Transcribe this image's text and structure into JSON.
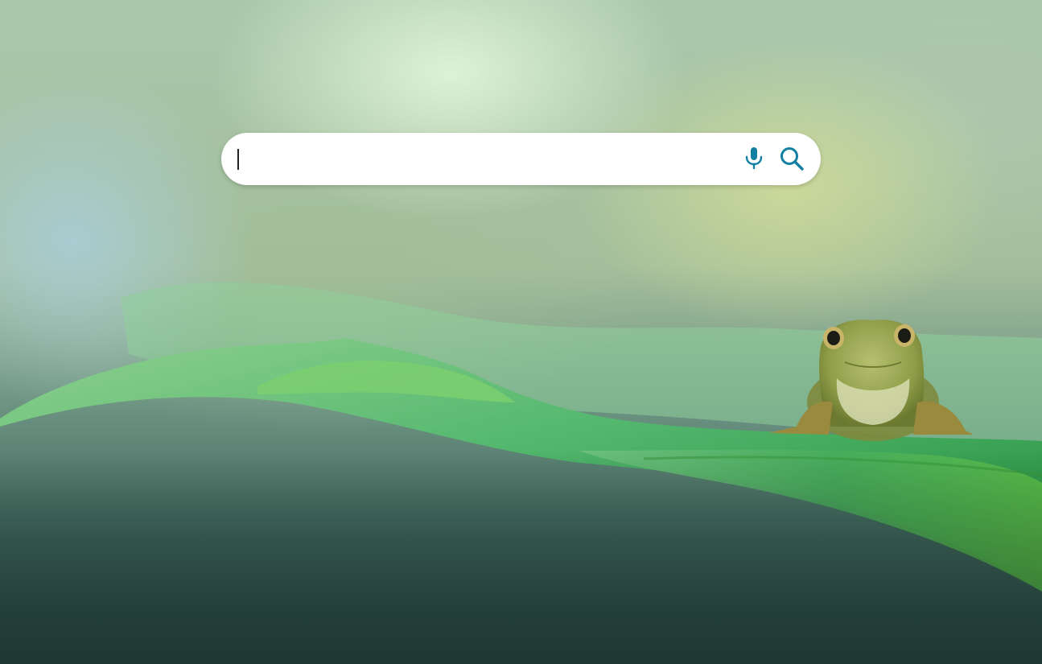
{
  "search": {
    "value": "",
    "placeholder": "",
    "mic_icon": "microphone-icon",
    "search_icon": "magnifier-icon"
  },
  "colors": {
    "icon_accent": "#137fa3",
    "searchbar_background": "#ffffff"
  },
  "background": {
    "subject": "frog-on-leaf"
  }
}
